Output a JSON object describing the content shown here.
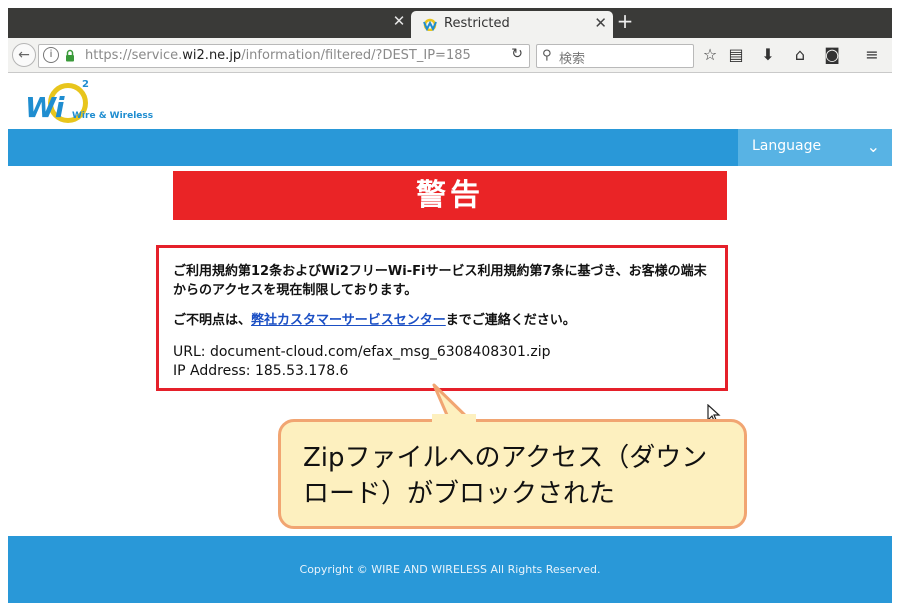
{
  "browser": {
    "tab": {
      "title": "Restricted"
    },
    "url": {
      "prefix": "https://service.",
      "host": "wi2.ne.jp",
      "path": "/information/filtered/?DEST_IP=185"
    },
    "search": {
      "placeholder": "検索"
    }
  },
  "site": {
    "logo": {
      "text": "Wi",
      "superscript": "2",
      "subtitle": "Wire & Wireless"
    },
    "language_label": "Language",
    "warning_title": "警告",
    "message": {
      "main": "ご利用規約第12条およびWi2フリーWi-Fiサービス利用規約第7条に基づき、お客様の端末からのアクセスを現在制限しております。",
      "contact_prefix": "ご不明点は、",
      "contact_link": "弊社カスタマーサービスセンター",
      "contact_suffix": "までご連絡ください。",
      "url_line": "URL: document-cloud.com/efax_msg_6308408301.zip",
      "ip_line": "IP Address: 185.53.178.6"
    },
    "footer": "Copyright © WIRE AND WIRELESS All Rights Reserved."
  },
  "annotation": {
    "callout_text": "Zipファイルへのアクセス（ダウンロード）がブロックされた"
  },
  "colors": {
    "brand_blue": "#2998d8",
    "warning_red": "#ea2426",
    "callout_fill": "#fdf0bf",
    "callout_border": "#f1a572"
  }
}
